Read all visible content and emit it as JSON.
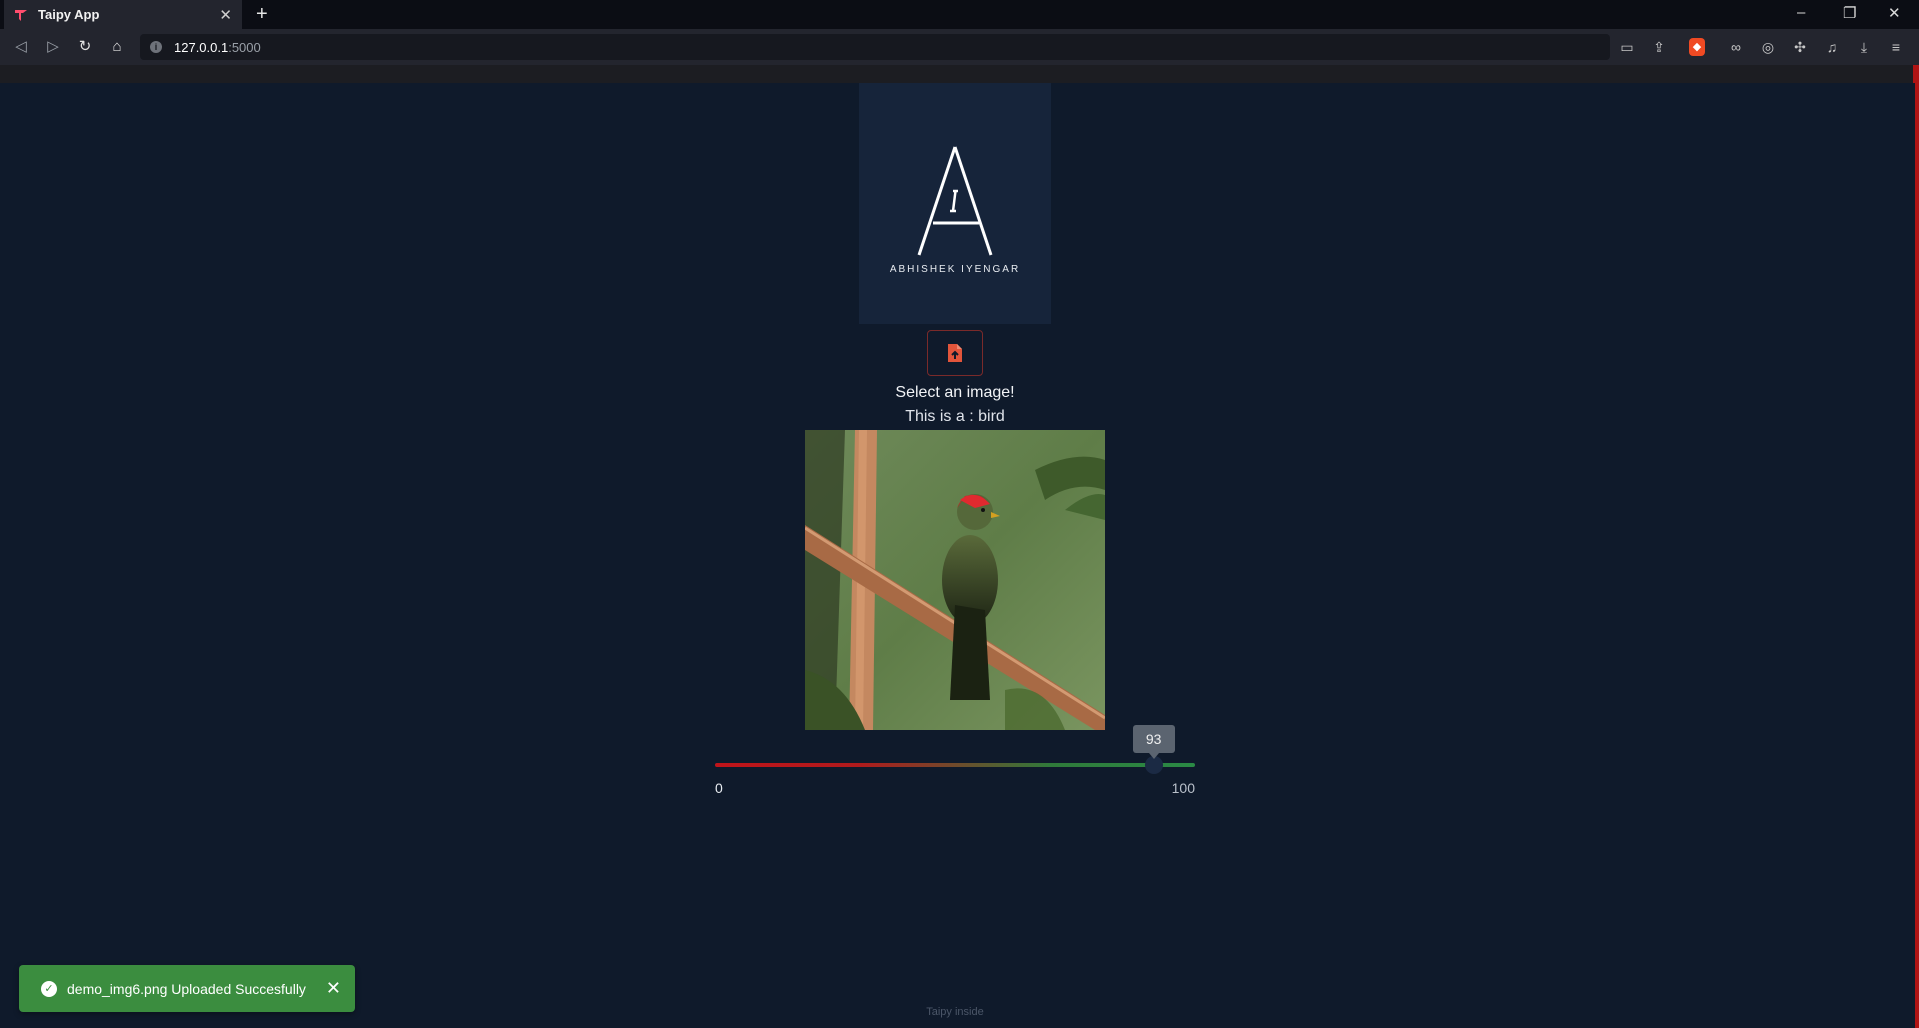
{
  "browser": {
    "tab_title": "Taipy App",
    "tab_close": "✕",
    "new_tab": "+",
    "url_host": "127.0.0.1",
    "url_port": ":5000",
    "window": {
      "minimize": "–",
      "restore": "❐",
      "close": "✕"
    }
  },
  "logo": {
    "caption": "ABHISHEK IYENGAR"
  },
  "upload": {
    "icon": "file-upload-icon"
  },
  "main": {
    "select_label": "Select an image!",
    "result_label": "This is a : bird"
  },
  "slider": {
    "min": 0,
    "max": 100,
    "value": 93,
    "min_label": "0",
    "max_label": "100",
    "value_label": "93"
  },
  "toast": {
    "message": "demo_img6.png Uploaded Succesfully",
    "close": "✕"
  },
  "footer": {
    "text": "Taipy inside"
  },
  "colors": {
    "accent": "#e2553b",
    "success": "#3b8d3f",
    "page_bg": "#0f1a2b"
  }
}
